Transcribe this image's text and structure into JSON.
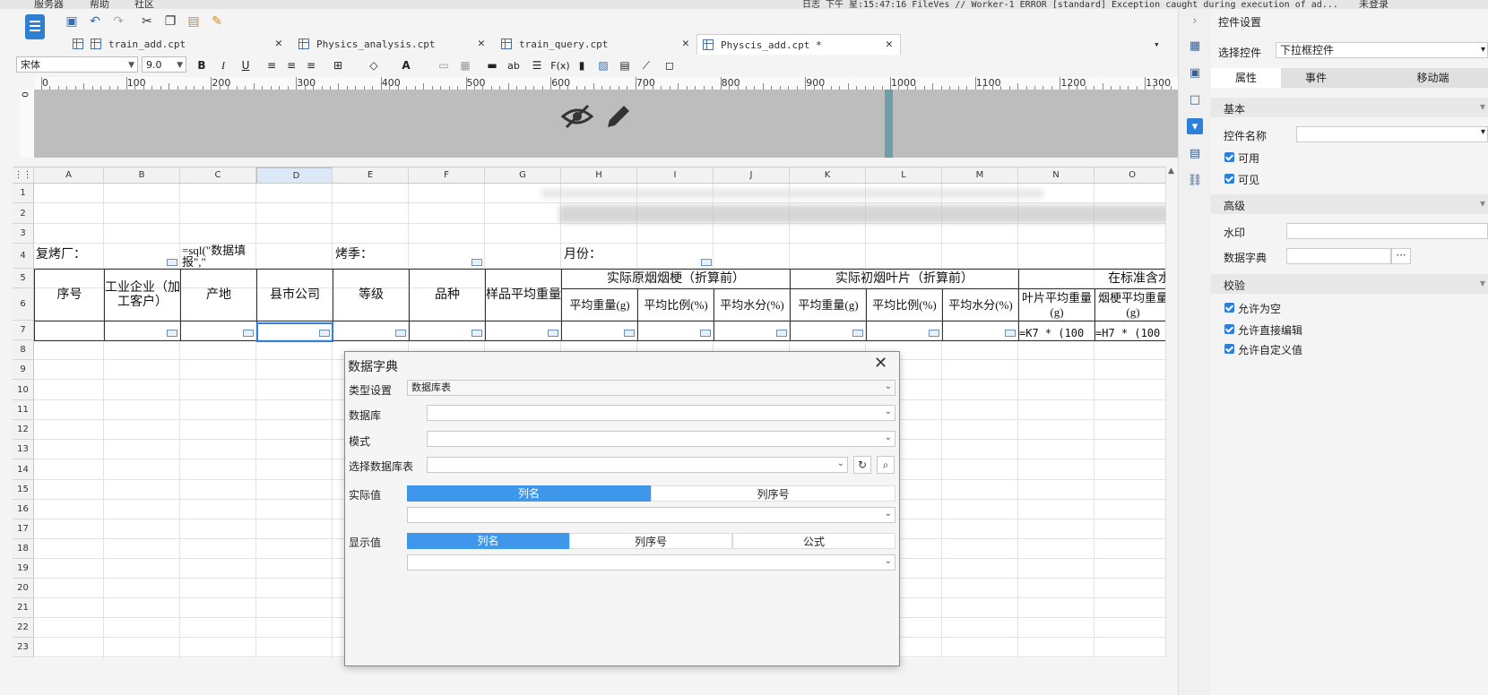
{
  "top_strip": {
    "menus": [
      "服务器",
      "帮助",
      "社区"
    ],
    "log_text": "日志 下午 星:15:47:16 FileVes // Worker-1 ERROR [standard] Exception caught during execution of ad...",
    "user": "未登录"
  },
  "toolbar": {
    "icons": [
      "save-icon",
      "undo-icon",
      "redo-icon",
      "cut-icon",
      "copy-icon",
      "paste-icon",
      "format-brush-icon"
    ]
  },
  "tabs": [
    {
      "label": "train_add.cpt"
    },
    {
      "label": "Physics_analysis.cpt"
    },
    {
      "label": "train_query.cpt"
    },
    {
      "label": "Physcis_add.cpt *"
    }
  ],
  "fontbar": {
    "font_family": "宋体",
    "font_size": "9.0",
    "bold": "B",
    "italic": "I",
    "underline": "U",
    "abc": "ab",
    "fx": "F(x)"
  },
  "ruler": {
    "ticks": [
      "0",
      "100",
      "200",
      "300",
      "400",
      "500",
      "600",
      "700",
      "800",
      "900",
      "1000",
      "1100",
      "1200",
      "1300"
    ],
    "vertical_zero": "0"
  },
  "sheet": {
    "columns": [
      "A",
      "B",
      "C",
      "D",
      "E",
      "F",
      "G",
      "H",
      "I",
      "J",
      "K",
      "L",
      "M",
      "N",
      "O"
    ],
    "selected_column": "D",
    "rows": [
      "1",
      "2",
      "3",
      "4",
      "5",
      "6",
      "7",
      "8",
      "9",
      "10",
      "11",
      "12",
      "13",
      "14",
      "15",
      "16",
      "17",
      "18",
      "19",
      "20",
      "21",
      "22",
      "23"
    ],
    "r4": {
      "a": "复烤厂：",
      "c": "=sql(\"数据填报\",\"",
      "e": "烤季：",
      "h": "月份："
    },
    "headers": {
      "a": "序号",
      "b": "工业企业（加工客户）",
      "c": "产地",
      "d": "县市公司",
      "e": "等级",
      "f": "品种",
      "g": "样品平均重量",
      "group1": "实际原烟烟梗（折算前）",
      "group2": "实际初烟叶片（折算前）",
      "group3": "在标准含水",
      "h": "平均重量(g)",
      "i": "平均比例(%)",
      "j": "平均水分(%)",
      "k": "平均重量(g)",
      "l": "平均比例(%)",
      "m": "平均水分(%)",
      "n": "叶片平均重量(g)",
      "o": "烟梗平均重量(g)"
    },
    "r7": {
      "n": "=K7 * (100",
      "o": "=H7 * (100"
    }
  },
  "right_panel": {
    "title": "控件设置",
    "select_label": "选择控件",
    "select_value": "下拉框控件",
    "tabs": [
      "属性",
      "事件",
      "移动端"
    ],
    "section_basic": "基本",
    "control_name": "控件名称",
    "check_enabled": "可用",
    "check_visible": "可见",
    "section_advanced": "高级",
    "watermark": "水印",
    "data_dict": "数据字典",
    "section_validate": "校验",
    "allow_empty": "允许为空",
    "allow_edit": "允许直接编辑",
    "allow_custom": "允许自定义值"
  },
  "dialog": {
    "title": "数据字典",
    "type_label": "类型设置",
    "type_value": "数据库表",
    "db_label": "数据库",
    "schema_label": "模式",
    "table_label": "选择数据库表",
    "actual_label": "实际值",
    "actual_tabs": [
      "列名",
      "列序号"
    ],
    "display_label": "显示值",
    "display_tabs": [
      "列名",
      "列序号",
      "公式"
    ]
  },
  "colors": {
    "accent": "#3f97ec",
    "checkbox": "#2d7fd8",
    "selected_col": "#dbe9f7"
  }
}
